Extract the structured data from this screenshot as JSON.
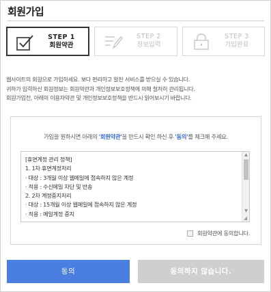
{
  "page": {
    "title": "회원가입"
  },
  "steps": [
    {
      "num": "STEP 1",
      "label": "회원약관",
      "state": "active",
      "icon": "checkbox-check-icon"
    },
    {
      "num": "STEP 2",
      "label": "정보입력",
      "state": "inactive",
      "icon": "form-pencil-icon"
    },
    {
      "num": "STEP 3",
      "label": "가입완료",
      "state": "inactive",
      "icon": "lock-icon"
    }
  ],
  "description": [
    "웹사이트의 회원으로 가입하세요. 보다 편리하고 알찬 서비스를 받으실 수 있습니다.",
    "귀하가 입력하신 회원정보는 회원약관과 개인정보보호정책에 의해 철저히 관리됩니다.",
    "회원가입전, 아래의 이용자약관 및 개인정보보호정책을 반드시 읽어보시기 바랍니다."
  ],
  "instruction": {
    "prefix": "가입을 원하시면 아래의 ",
    "terms_link": "'회원약관'",
    "middle": "을 반드시 확인 하신 후 ",
    "agree_word": "'동의'",
    "suffix": "를 체크해 주세요."
  },
  "terms": [
    "[휴면계정 관리 정책]",
    "1. 1차 휴면계정처리",
    "  · 대상 : 3개월 이상 웹메일에 접속하지 않은 계정",
    "  · 적용 : 수신메일 차단 및 반송",
    "2. 2차 계정중지처리",
    "  · 대상 : 15개월 이상 웹메일에 접속하지 않은 계정",
    "  · 적용 : 메일계정 중지"
  ],
  "agree_checkbox": {
    "label": "회원약관에 동의합니다.",
    "checked": false
  },
  "buttons": {
    "agree": "동의",
    "disagree": "동의하지 않습니다."
  },
  "colors": {
    "accent": "#4a7ee0",
    "highlight": "#3a6fd8",
    "disabled": "#cfcfcf"
  }
}
